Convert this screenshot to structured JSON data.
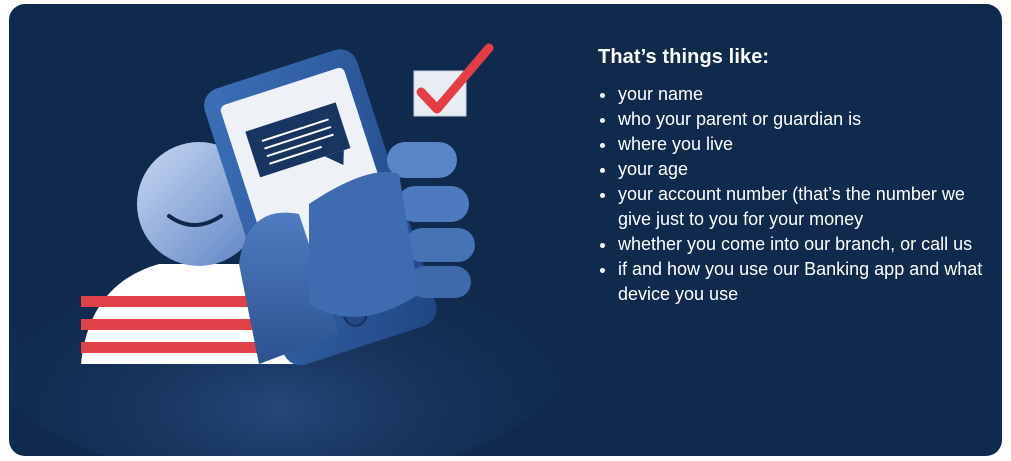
{
  "heading": "That’s things like:",
  "items": [
    "your name",
    "who your parent or guardian is",
    "where you live",
    "your age",
    "your account number (that’s the number we give just to you for your money",
    "whether you come into our branch, or call us",
    "if and how you use our Banking app and what device you use"
  ],
  "colors": {
    "background": "#0f2a4d",
    "checkmark": "#e63c46",
    "stripe_red": "#e04048",
    "phone_blue": "#2f5fa8"
  },
  "illustration": {
    "subject": "smiling-person-with-phone-icon",
    "accent": "checkbox-checked-icon"
  }
}
